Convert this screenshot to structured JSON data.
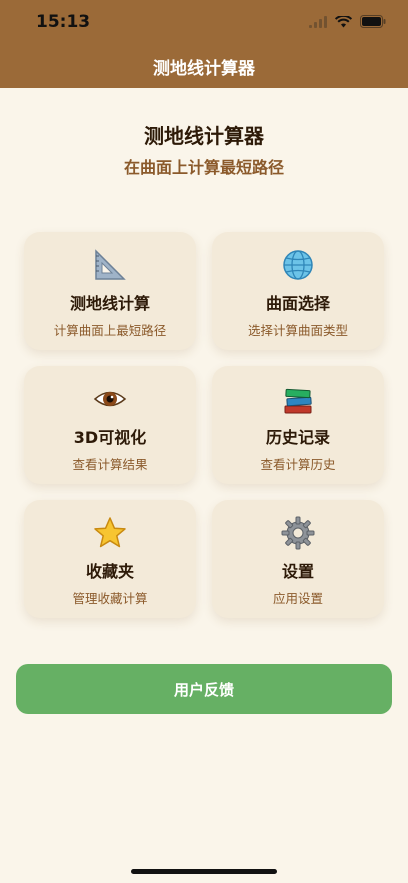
{
  "status_bar": {
    "time": "15:13"
  },
  "nav": {
    "title": "测地线计算器"
  },
  "page": {
    "title": "测地线计算器",
    "subtitle": "在曲面上计算最短路径"
  },
  "cards": [
    {
      "icon": "triangle-ruler-icon",
      "title": "测地线计算",
      "desc": "计算曲面上最短路径"
    },
    {
      "icon": "globe-icon",
      "title": "曲面选择",
      "desc": "选择计算曲面类型"
    },
    {
      "icon": "eye-icon",
      "title": "3D可视化",
      "desc": "查看计算结果"
    },
    {
      "icon": "books-icon",
      "title": "历史记录",
      "desc": "查看计算历史"
    },
    {
      "icon": "star-icon",
      "title": "收藏夹",
      "desc": "管理收藏计算"
    },
    {
      "icon": "gear-icon",
      "title": "设置",
      "desc": "应用设置"
    }
  ],
  "feedback_button": {
    "label": "用户反馈"
  },
  "colors": {
    "header": "#9b6a38",
    "background": "#faf5ea",
    "card": "#f3ead9",
    "feedback": "#66b064",
    "accent_text": "#8b5a2b"
  }
}
